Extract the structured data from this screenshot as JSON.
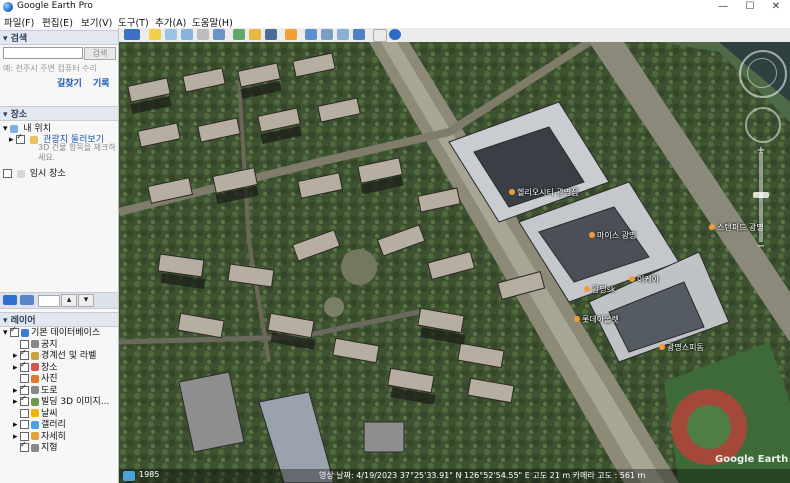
{
  "window": {
    "title": "Google Earth Pro",
    "minimize_glyph": "—",
    "maximize_glyph": "☐",
    "close_glyph": "✕"
  },
  "menu": {
    "items": [
      "파일(F)",
      "편집(E)",
      "보기(V)",
      "도구(T)",
      "추가(A)",
      "도움말(H)"
    ]
  },
  "search": {
    "header": "검색",
    "button": "검색",
    "placeholder": "예: 천주시 주변 컴퓨터 수리",
    "directions_link": "길찾기",
    "history_link": "기록"
  },
  "places": {
    "header": "장소",
    "my_places": "내 위치",
    "sightseeing": "관광지 둘러보기",
    "hint": "3D 건물 항목을 체크하세요.",
    "temp_places": "임시 장소"
  },
  "layers": {
    "header": "레이어",
    "items": [
      {
        "label": "기본 데이터베이스",
        "checked": true,
        "icon": "globe-icon",
        "color": "#3a7bd5"
      },
      {
        "label": "공지",
        "checked": false,
        "icon": "notice-icon",
        "color": "#888888"
      },
      {
        "label": "경계선 및 라벨",
        "checked": true,
        "icon": "borders-icon",
        "color": "#c8a23a"
      },
      {
        "label": "장소",
        "checked": true,
        "icon": "place-icon",
        "color": "#d9534f"
      },
      {
        "label": "사진",
        "checked": false,
        "icon": "photo-icon",
        "color": "#e07a2e"
      },
      {
        "label": "도로",
        "checked": true,
        "icon": "road-icon",
        "color": "#888888"
      },
      {
        "label": "빌딩 3D 이미지...",
        "checked": true,
        "icon": "building-icon",
        "color": "#6a9c4a"
      },
      {
        "label": "날씨",
        "checked": false,
        "icon": "weather-icon",
        "color": "#f0b400"
      },
      {
        "label": "갤러리",
        "checked": false,
        "icon": "gallery-icon",
        "color": "#4aa3df"
      },
      {
        "label": "자세히",
        "checked": false,
        "icon": "more-icon",
        "color": "#e6a23c"
      },
      {
        "label": "지형",
        "checked": true,
        "icon": "terrain-icon",
        "color": "#888888"
      }
    ]
  },
  "map": {
    "labels": [
      "광명sk",
      "헬리오시티 광명점",
      "마이스 광명",
      "스탠퍼드 광명",
      "이케아",
      "롯데아울렛",
      "광명스피돔"
    ],
    "watermark": "Google Earth",
    "status_year": "1985",
    "status_info": "영상 날짜: 4/19/2023   37°25'33.91\" N   126°52'54.55\" E   고도  21 m   카메라 고도 :  561 m"
  },
  "colors": {
    "panel_header_bg": "#e3e8f0",
    "link_blue": "#1a55b0"
  }
}
